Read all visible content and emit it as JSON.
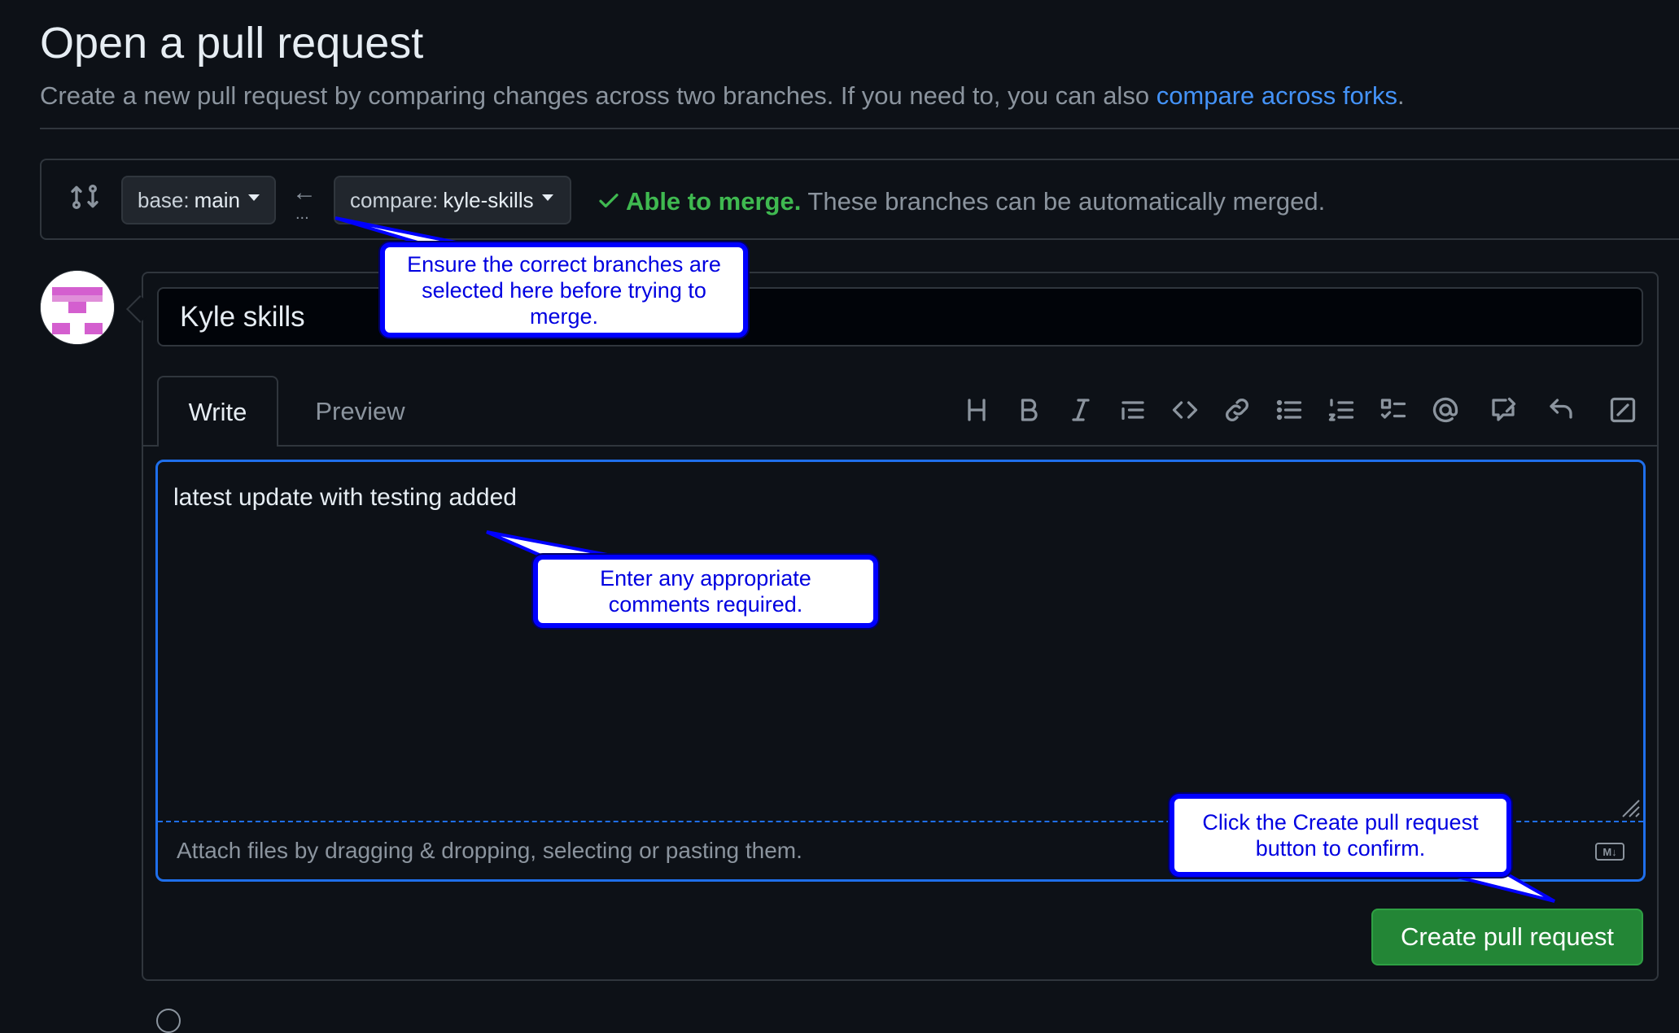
{
  "header": {
    "title": "Open a pull request",
    "subtitle": "Create a new pull request by comparing changes across two branches. If you need to, you can also",
    "forks_link": "compare across forks",
    "forks_suffix": "."
  },
  "range": {
    "base_prefix": "base:",
    "base_value": "main",
    "arrow": "←",
    "dots": "...",
    "compare_prefix": "compare:",
    "compare_value": "kyle-skills",
    "merge_status": "Able to merge.",
    "merge_detail": "These branches can be automatically merged."
  },
  "form": {
    "title_value": "Kyle skills",
    "tabs": [
      {
        "label": "Write"
      },
      {
        "label": "Preview"
      }
    ],
    "body_text": "latest update with testing added",
    "attach_text": "Attach files by dragging & dropping, selecting or pasting them.",
    "markdown_badge": "M↓",
    "submit_label": "Create pull request"
  },
  "toolbar": {
    "icons": [
      "heading-icon",
      "bold-icon",
      "italic-icon",
      "quote-icon",
      "code-icon",
      "link-icon",
      "bullet-list-icon",
      "numbered-list-icon",
      "task-list-icon",
      "mention-icon",
      "reference-icon",
      "reply-icon",
      "slash-command-icon"
    ]
  },
  "callouts": {
    "branches": "Ensure the correct branches are selected here before trying to merge.",
    "comments": "Enter any appropriate comments required.",
    "create": "Click the Create pull request button to confirm."
  },
  "colors": {
    "background": "#0d1117",
    "accent_blue": "#4493f8",
    "success_green": "#3fb950",
    "button_green": "#238636",
    "callout_border": "#0000ff",
    "callout_text": "#0000e0"
  }
}
